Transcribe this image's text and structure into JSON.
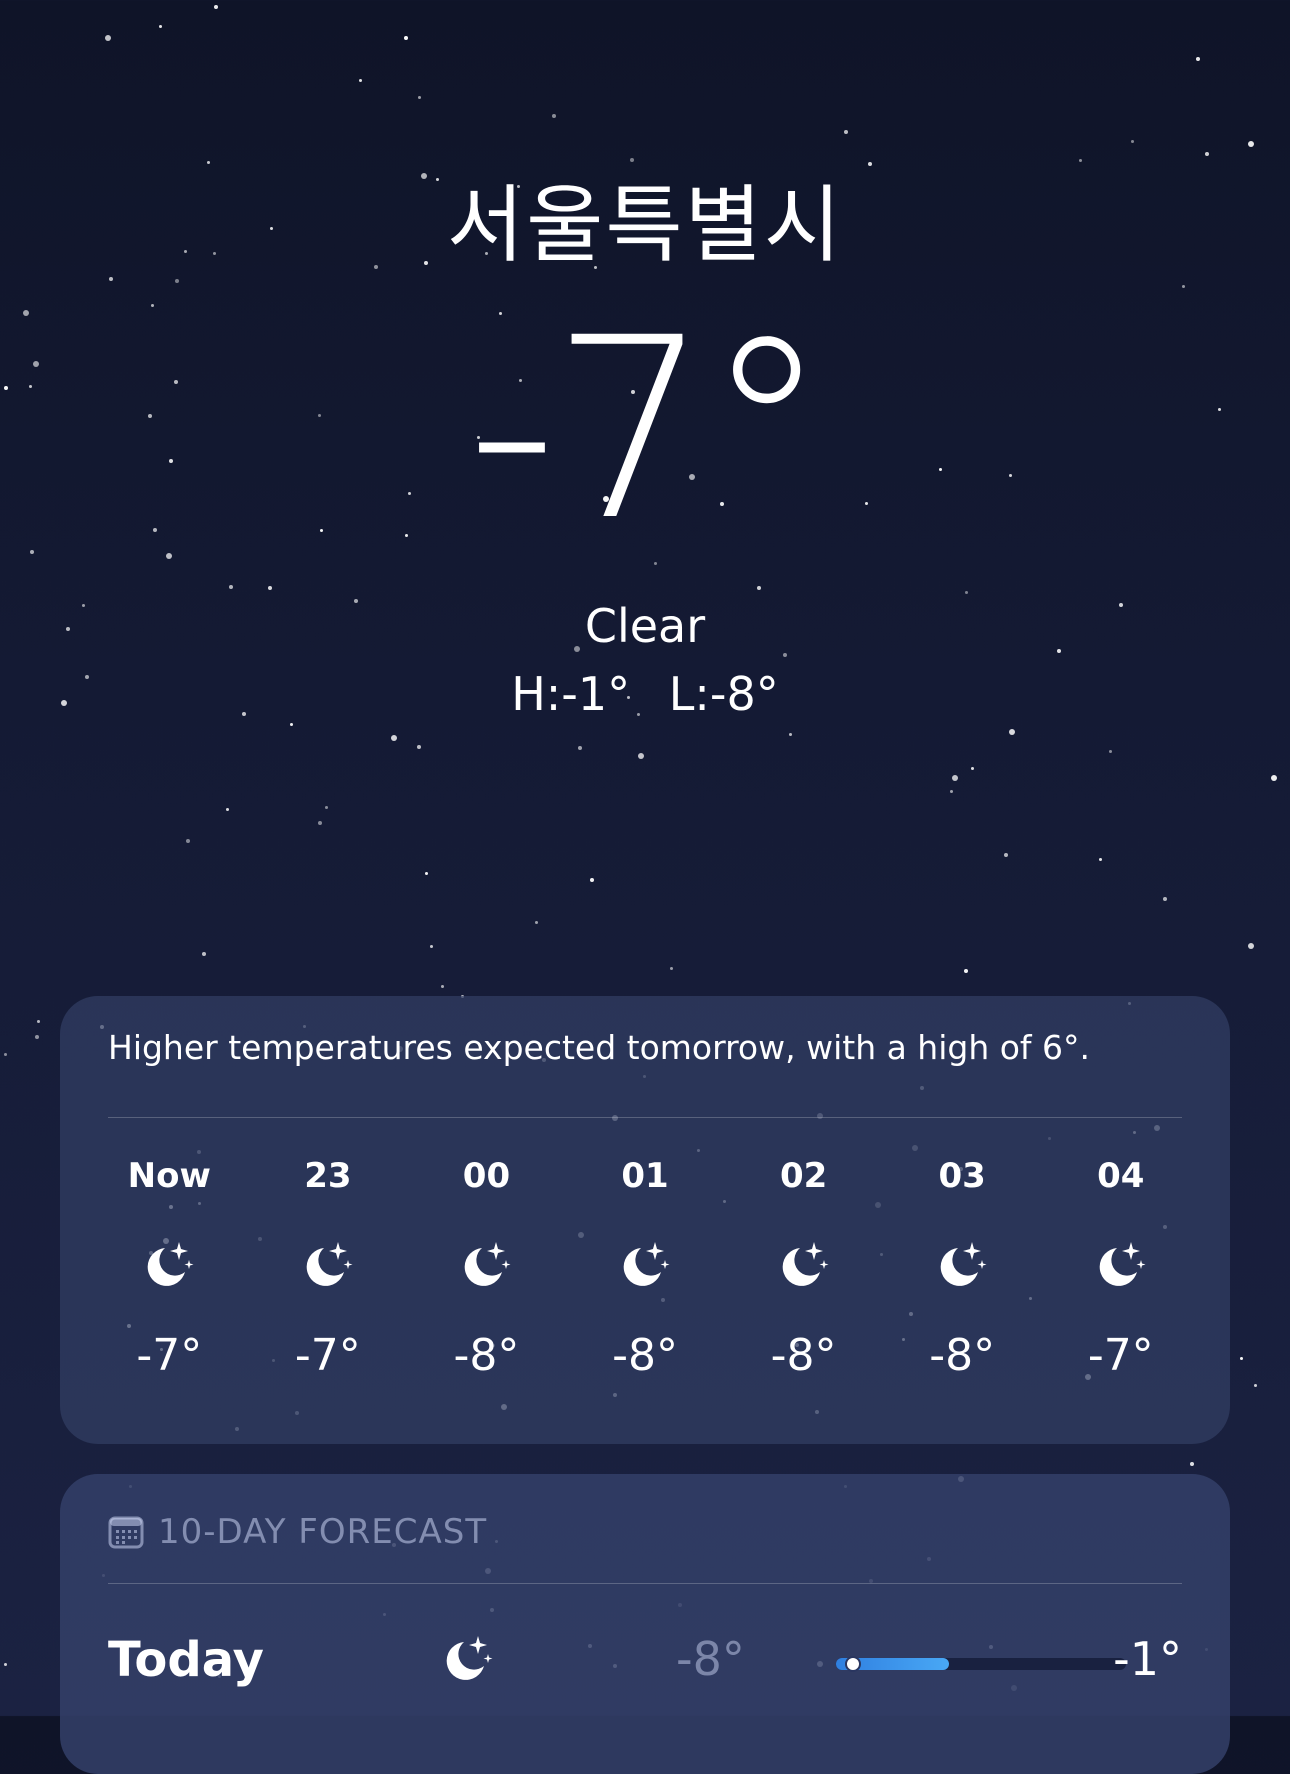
{
  "location": {
    "city": "서울특별시"
  },
  "current": {
    "temperature": "-7°",
    "condition": "Clear",
    "high": "H:-1°",
    "low": "L:-8°"
  },
  "hourly": {
    "summary": "Higher temperatures expected tomorrow, with a high of 6°.",
    "hours": [
      {
        "label": "Now",
        "icon": "moon-stars-icon",
        "temp": "-7°"
      },
      {
        "label": "23",
        "icon": "moon-stars-icon",
        "temp": "-7°"
      },
      {
        "label": "00",
        "icon": "moon-stars-icon",
        "temp": "-8°"
      },
      {
        "label": "01",
        "icon": "moon-stars-icon",
        "temp": "-8°"
      },
      {
        "label": "02",
        "icon": "moon-stars-icon",
        "temp": "-8°"
      },
      {
        "label": "03",
        "icon": "moon-stars-icon",
        "temp": "-8°"
      },
      {
        "label": "04",
        "icon": "moon-stars-icon",
        "temp": "-7°"
      }
    ]
  },
  "forecast": {
    "title": "10-DAY FORECAST",
    "icon": "calendar-icon",
    "days": [
      {
        "day": "Today",
        "icon": "moon-stars-icon",
        "low": "-8°",
        "high": "-1°",
        "current_position": 0.03,
        "range_start": 0.0,
        "range_end": 0.39
      }
    ]
  },
  "colors": {
    "background_top": "#0f1428",
    "card": "#323e64",
    "range_bar": "#49a8f5"
  }
}
